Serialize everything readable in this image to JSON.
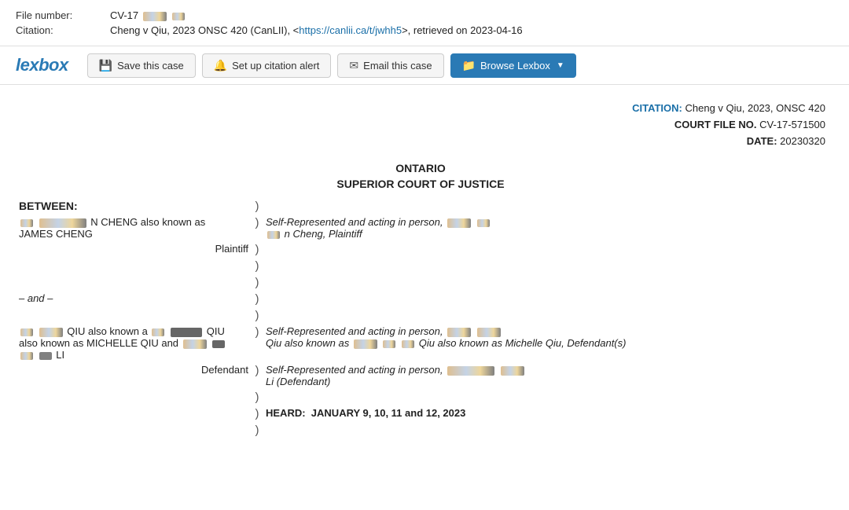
{
  "metadata": {
    "file_number_label": "File number:",
    "file_number_value": "CV-17",
    "citation_label": "Citation:",
    "citation_text_before": "Cheng v Qiu, 2023 ONSC 420 (CanLII), <",
    "citation_link_text": "https://canlii.ca/t/jwhh5",
    "citation_link_href": "https://canlii.ca/t/jwhh5",
    "citation_text_after": ">, retrieved on 2023-04-16"
  },
  "toolbar": {
    "logo": "lexbox",
    "save_label": "Save this case",
    "citation_alert_label": "Set up citation alert",
    "email_label": "Email this case",
    "browse_label": "Browse Lexbox"
  },
  "citation_block": {
    "citation_label": "CITATION:",
    "citation_value": "Cheng v Qiu, 2023, ONSC 420",
    "file_no_label": "COURT FILE NO.",
    "file_no_value": "CV-17-571500",
    "date_label": "DATE:",
    "date_value": "20230320"
  },
  "court": {
    "jurisdiction": "ONTARIO",
    "court_name": "SUPERIOR COURT OF JUSTICE"
  },
  "parties": {
    "between_label": "BETWEEN:",
    "plaintiff_name": "N CHENG also known as JAMES CHENG",
    "plaintiff_role": "Plaintiff",
    "and_separator": "– and –",
    "defendant_name": "QIU also known as QIU also known as MICHELLE QIU and LI",
    "defendant_role": "Defendant",
    "self_rep_plaintiff": "Self-Represented and acting in person,",
    "self_rep_plaintiff2": "n Cheng, Plaintiff",
    "self_rep_defendant1": "Self-Represented and acting in person,",
    "self_rep_defendant2": "Qiu also known as",
    "self_rep_defendant3": "Qiu also known as Michelle Qiu, Defendant(s)",
    "self_rep_defendant4": "Self-Represented and acting in person,",
    "self_rep_defendant5": "Li (Defendant)",
    "heard_label": "HEARD:",
    "heard_value": "JANUARY 9, 10, 11 and 12, 2023"
  }
}
